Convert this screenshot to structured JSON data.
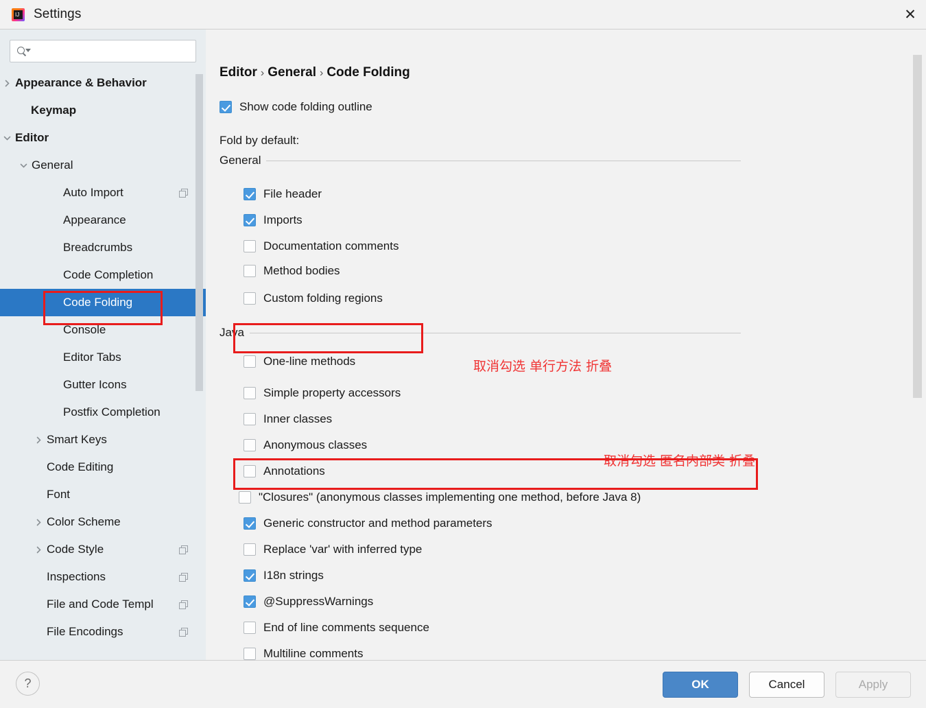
{
  "window": {
    "title": "Settings",
    "app_icon": "intellij-idea-icon",
    "close_icon": "close-icon"
  },
  "sidebar": {
    "search": {
      "placeholder": "",
      "value": "",
      "icon": "search-icon"
    },
    "items": [
      {
        "label": "Appearance & Behavior",
        "indent": 22,
        "bold": true,
        "twisty": "chevron-right",
        "copy": false,
        "selected": false
      },
      {
        "label": "Keymap",
        "indent": 45,
        "bold": true,
        "twisty": "none",
        "copy": false,
        "selected": false
      },
      {
        "label": "Editor",
        "indent": 22,
        "bold": true,
        "twisty": "chevron-down",
        "copy": false,
        "selected": false
      },
      {
        "label": "General",
        "indent": 46,
        "bold": false,
        "twisty": "chevron-down",
        "copy": false,
        "selected": false
      },
      {
        "label": "Auto Import",
        "indent": 92,
        "bold": false,
        "twisty": "none",
        "copy": true,
        "selected": false
      },
      {
        "label": "Appearance",
        "indent": 92,
        "bold": false,
        "twisty": "none",
        "copy": false,
        "selected": false
      },
      {
        "label": "Breadcrumbs",
        "indent": 92,
        "bold": false,
        "twisty": "none",
        "copy": false,
        "selected": false
      },
      {
        "label": "Code Completion",
        "indent": 92,
        "bold": false,
        "twisty": "none",
        "copy": false,
        "selected": false
      },
      {
        "label": "Code Folding",
        "indent": 92,
        "bold": false,
        "twisty": "none",
        "copy": false,
        "selected": true
      },
      {
        "label": "Console",
        "indent": 92,
        "bold": false,
        "twisty": "none",
        "copy": false,
        "selected": false
      },
      {
        "label": "Editor Tabs",
        "indent": 92,
        "bold": false,
        "twisty": "none",
        "copy": false,
        "selected": false
      },
      {
        "label": "Gutter Icons",
        "indent": 92,
        "bold": false,
        "twisty": "none",
        "copy": false,
        "selected": false
      },
      {
        "label": "Postfix Completion",
        "indent": 92,
        "bold": false,
        "twisty": "none",
        "copy": false,
        "selected": false
      },
      {
        "label": "Smart Keys",
        "indent": 68,
        "bold": false,
        "twisty": "chevron-right",
        "copy": false,
        "selected": false
      },
      {
        "label": "Code Editing",
        "indent": 68,
        "bold": false,
        "twisty": "none",
        "copy": false,
        "selected": false
      },
      {
        "label": "Font",
        "indent": 68,
        "bold": false,
        "twisty": "none",
        "copy": false,
        "selected": false
      },
      {
        "label": "Color Scheme",
        "indent": 68,
        "bold": false,
        "twisty": "chevron-right",
        "copy": false,
        "selected": false
      },
      {
        "label": "Code Style",
        "indent": 68,
        "bold": false,
        "twisty": "chevron-right",
        "copy": true,
        "selected": false
      },
      {
        "label": "Inspections",
        "indent": 68,
        "bold": false,
        "twisty": "none",
        "copy": true,
        "selected": false
      },
      {
        "label": "File and Code Templ",
        "indent": 68,
        "bold": false,
        "twisty": "none",
        "copy": true,
        "selected": false
      },
      {
        "label": "File Encodings",
        "indent": 68,
        "bold": false,
        "twisty": "none",
        "copy": true,
        "selected": false
      }
    ]
  },
  "main": {
    "breadcrumb": {
      "part1": "Editor",
      "part2": "General",
      "part3": "Code Folding",
      "separator": "›"
    },
    "show_outline": {
      "label": "Show code folding outline",
      "checked": true
    },
    "fold_by_default_label": "Fold by default:",
    "groups": [
      {
        "title": "General",
        "options": [
          {
            "label": "File header",
            "checked": true
          },
          {
            "label": "Imports",
            "checked": true
          },
          {
            "label": "Documentation comments",
            "checked": false
          },
          {
            "label": "Method bodies",
            "checked": false
          },
          {
            "label": "Custom folding regions",
            "checked": false
          }
        ]
      },
      {
        "title": "Java",
        "options": [
          {
            "label": "One-line methods",
            "checked": false
          },
          {
            "label": "Simple property accessors",
            "checked": false
          },
          {
            "label": "Inner classes",
            "checked": false
          },
          {
            "label": "Anonymous classes",
            "checked": false
          },
          {
            "label": "Annotations",
            "checked": false
          },
          {
            "label": "\"Closures\" (anonymous classes implementing one method, before Java 8)",
            "checked": false
          },
          {
            "label": "Generic constructor and method parameters",
            "checked": true
          },
          {
            "label": "Replace 'var' with inferred type",
            "checked": false
          },
          {
            "label": "I18n strings",
            "checked": true
          },
          {
            "label": "@SuppressWarnings",
            "checked": true
          },
          {
            "label": "End of line comments sequence",
            "checked": false
          },
          {
            "label": "Multiline comments",
            "checked": false
          }
        ]
      }
    ],
    "annotations": [
      {
        "text": "取消勾选 单行方法 折叠"
      },
      {
        "text": "取消勾选 匿名内部类 折叠"
      }
    ]
  },
  "footer": {
    "help_label": "?",
    "ok_label": "OK",
    "cancel_label": "Cancel",
    "apply_label": "Apply"
  },
  "colors": {
    "accent_blue": "#2b78c5",
    "checkbox_blue": "#4a9ae0",
    "annotation_red": "#f03434",
    "highlight_box_red": "#e81c1c",
    "sidebar_bg": "#e8edf0",
    "panel_bg": "#f2f2f2"
  }
}
